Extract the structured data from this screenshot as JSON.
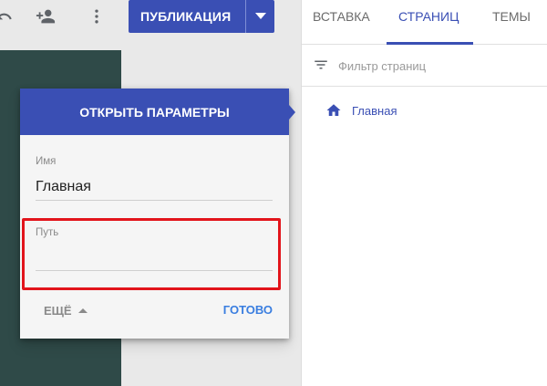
{
  "toolbar": {
    "publish_label": "ПУБЛИКАЦИЯ",
    "icons": [
      "undo-icon",
      "add-person-icon",
      "more-vert-icon",
      "dropdown-arrow-icon"
    ]
  },
  "tabs": [
    {
      "label": "ВСТАВКА",
      "active": false
    },
    {
      "label": "СТРАНИЦ",
      "active": true
    },
    {
      "label": "ТЕМЫ",
      "active": false
    }
  ],
  "filter": {
    "placeholder": "Фильтр страниц",
    "value": ""
  },
  "pages": [
    {
      "label": "Главная",
      "icon": "home-icon"
    }
  ],
  "card": {
    "header": "ОТКРЫТЬ ПАРАМЕТРЫ",
    "name_label": "Имя",
    "name_value": "Главная",
    "path_label": "Путь",
    "path_value": "",
    "more_label": "ЕЩЁ",
    "done_label": "ГОТОВО"
  },
  "colors": {
    "accent": "#3a4fb4",
    "done_link": "#3a7ee0",
    "highlight": "#e2141b",
    "preview_bg": "#2f4a48"
  }
}
